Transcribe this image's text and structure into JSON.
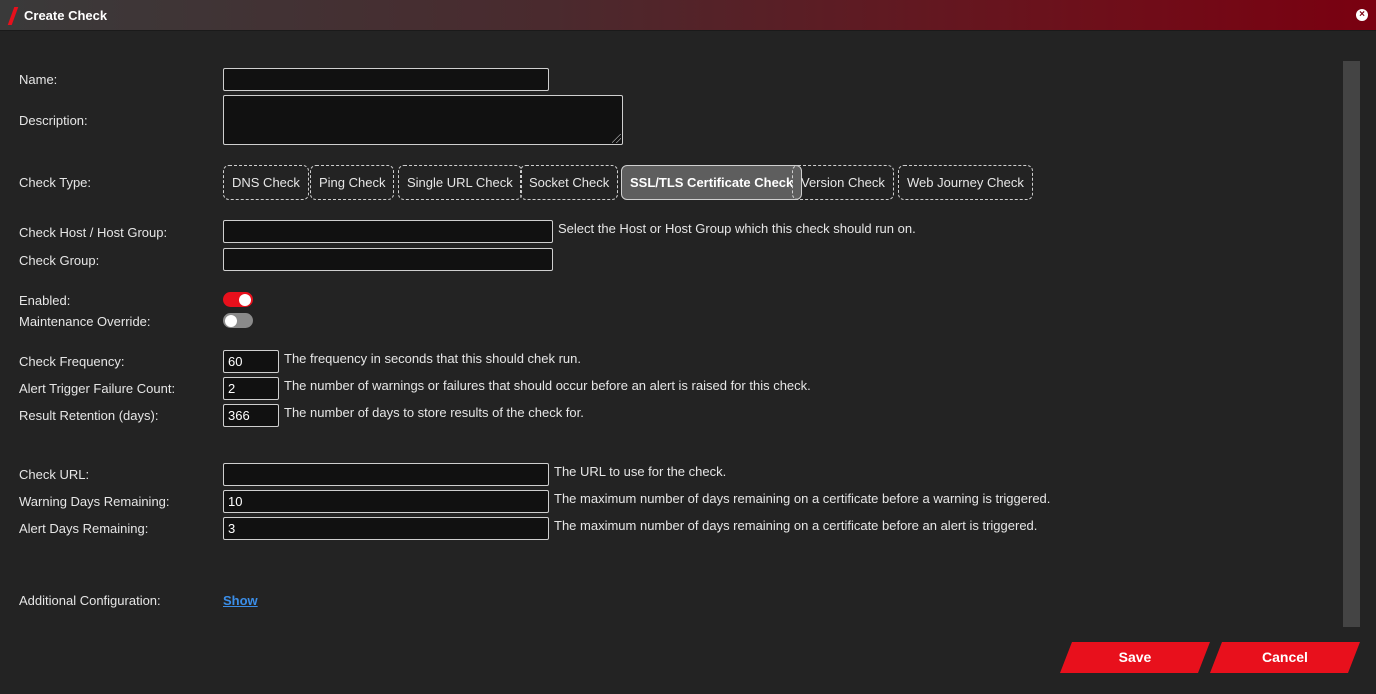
{
  "dialog": {
    "title": "Create Check",
    "close_glyph": "×"
  },
  "form": {
    "name_label": "Name:",
    "description_label": "Description:",
    "check_type_label": "Check Type:",
    "check_types": [
      "DNS Check",
      "Ping Check",
      "Single URL Check",
      "Socket Check",
      "SSL/TLS Certificate Check",
      "Version Check",
      "Web Journey Check"
    ],
    "active_check_type": "SSL/TLS Certificate Check",
    "host_label": "Check Host / Host Group:",
    "host_help": "Select the Host or Host Group which this check should run on.",
    "group_label": "Check Group:",
    "enabled_label": "Enabled:",
    "enabled": true,
    "maintenance_label": "Maintenance Override:",
    "maintenance": false,
    "frequency_label": "Check Frequency:",
    "frequency_value": "60",
    "frequency_help": "The frequency in seconds that this should chek run.",
    "failure_label": "Alert Trigger Failure Count:",
    "failure_value": "2",
    "failure_help": "The number of warnings or failures that should occur before an alert is raised for this check.",
    "retention_label": "Result Retention (days):",
    "retention_value": "366",
    "retention_help": "The number of days to store results of the check for.",
    "url_label": "Check URL:",
    "url_help": "The URL to use for the check.",
    "warning_label": "Warning Days Remaining:",
    "warning_value": "10",
    "warning_help": "The maximum number of days remaining on a certificate before a warning is triggered.",
    "alert_label": "Alert Days Remaining:",
    "alert_value": "3",
    "alert_help": "The maximum number of days remaining on a certificate before an alert is triggered.",
    "additional_label": "Additional Configuration:",
    "additional_link": "Show"
  },
  "actions": {
    "save": "Save",
    "cancel": "Cancel"
  },
  "colors": {
    "accent": "#e8101c",
    "link": "#3b8ee8",
    "background": "#232323"
  }
}
